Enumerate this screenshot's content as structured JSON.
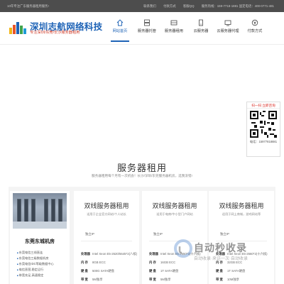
{
  "topbar": {
    "left_text": "10年专注广东服务器租用服务!",
    "links": [
      "联系我们",
      "付款方式",
      "客服QQ",
      "服务热线：159-7718-1881 固定电话：400-0771-481"
    ]
  },
  "brand": {
    "name": "深圳志航网络科技",
    "slogan": "专注深圳/东莞/长沙服务器租用"
  },
  "nav": [
    {
      "label": "网站首页",
      "icon": "home-icon",
      "active": true
    },
    {
      "label": "服务器托管",
      "icon": "server-icon"
    },
    {
      "label": "服务器租用",
      "icon": "server-rack-icon"
    },
    {
      "label": "云服务器",
      "icon": "cloud-icon"
    },
    {
      "label": "云服务器代理",
      "icon": "cloud-proxy-icon"
    },
    {
      "label": "付款方式",
      "icon": "payment-icon"
    }
  ],
  "side_qr": {
    "title": "扫一扫 立即咨询",
    "phone": "电话：15977818881"
  },
  "section": {
    "title": "服务器租用",
    "subtitle": "服务器租用每个月有一次机会！长沙/深圳/东莞服务器机房，选我没错!"
  },
  "room": {
    "name": "东莞东城机房",
    "features": [
      "东莞电信三线直连",
      "东莞电信三级数据机房",
      "东莞电信IDC等级数据中心",
      "电信直营,稳定运行",
      "带宽充足,高速稳定"
    ]
  },
  "products": [
    {
      "title": "双线服务器租用",
      "desc": "适用于企业官方网站/个人站长",
      "ip": "独立IP",
      "specs": [
        {
          "k": "处理器",
          "v": "Intel Xeon E5-2620/5645*2(八核)"
        },
        {
          "k": "内 存",
          "v": "8GB ECC"
        },
        {
          "k": "硬 盘",
          "v": "500G SATA硬盘"
        },
        {
          "k": "带 宽",
          "v": "5M独享"
        }
      ]
    },
    {
      "title": "双线服务器租用",
      "desc": "适用于电商/中小型门户网站",
      "ip": "独立IP",
      "specs": [
        {
          "k": "处理器",
          "v": "Intel Xeon E5-2650*2(十六核)"
        },
        {
          "k": "内 存",
          "v": "16GB ECC"
        },
        {
          "k": "硬 盘",
          "v": "1T SATA硬盘"
        },
        {
          "k": "带 宽",
          "v": "5M独享"
        }
      ]
    },
    {
      "title": "双线服务器租用",
      "desc": "适用于网上商城，游戏网站等",
      "ip": "独立IP",
      "specs": [
        {
          "k": "处理器",
          "v": "Intel Xeon E5-2660*2(十六核)"
        },
        {
          "k": "内 存",
          "v": "32GB ECC"
        },
        {
          "k": "硬 盘",
          "v": "1T SATA硬盘"
        },
        {
          "k": "带 宽",
          "v": "10M独享"
        }
      ]
    }
  ],
  "watermark": {
    "title": "自动秒收录",
    "sub": "自动收录·来访一次·自动收录"
  },
  "colors": {
    "brand_blue": "#1e63b6",
    "slogan_red": "#cf3a27",
    "topbar_bg": "#4d4d4d"
  }
}
